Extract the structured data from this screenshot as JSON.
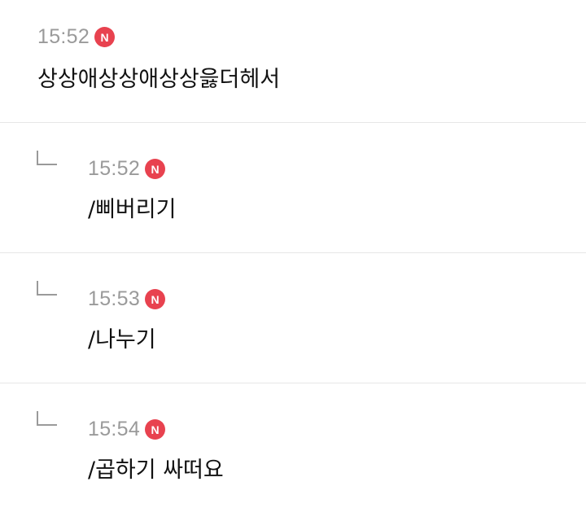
{
  "comments": [
    {
      "time": "15:52",
      "badge": "N",
      "text": "상상애상상애상상읋더헤서"
    },
    {
      "time": "15:52",
      "badge": "N",
      "text": "/삐버리기"
    },
    {
      "time": "15:53",
      "badge": "N",
      "text": "/나누기"
    },
    {
      "time": "15:54",
      "badge": "N",
      "text": "/곱하기 싸떠요"
    }
  ],
  "colors": {
    "badge": "#e8424f",
    "time": "#9a9a9a",
    "divider": "#e6e6e6"
  },
  "icons": {
    "reply": "reply-arrow-icon",
    "new": "new-badge"
  }
}
